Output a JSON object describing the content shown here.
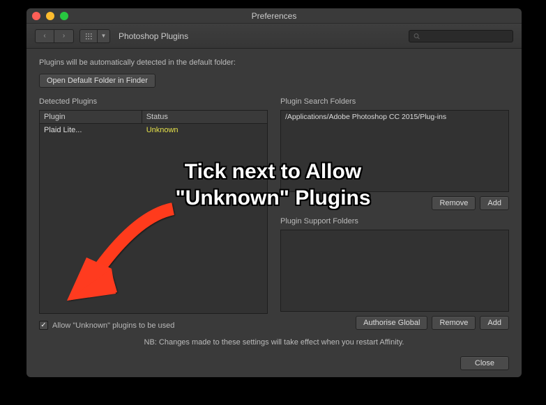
{
  "window": {
    "title": "Preferences",
    "section": "Photoshop Plugins"
  },
  "search": {
    "placeholder": ""
  },
  "description": "Plugins will be automatically detected in the default folder:",
  "buttons": {
    "open_default": "Open Default Folder in Finder",
    "remove": "Remove",
    "add": "Add",
    "authorise_global": "Authorise Global",
    "close": "Close"
  },
  "left": {
    "heading": "Detected Plugins",
    "columns": {
      "plugin": "Plugin",
      "status": "Status"
    },
    "rows": [
      {
        "plugin": "Plaid Lite...",
        "status": "Unknown"
      }
    ]
  },
  "right": {
    "heading1": "Plugin Search Folders",
    "paths": [
      "/Applications/Adobe Photoshop CC 2015/Plug-ins"
    ],
    "heading2": "Plugin Support Folders"
  },
  "checkbox_label": "Allow \"Unknown\" plugins to be used",
  "note": "NB: Changes made to these settings will take effect when you restart Affinity.",
  "annotation": {
    "line1": "Tick next to Allow",
    "line2": "\"Unknown\" Plugins"
  },
  "colors": {
    "status_unknown": "#e6e24a",
    "arrow": "#ff3b1f"
  }
}
